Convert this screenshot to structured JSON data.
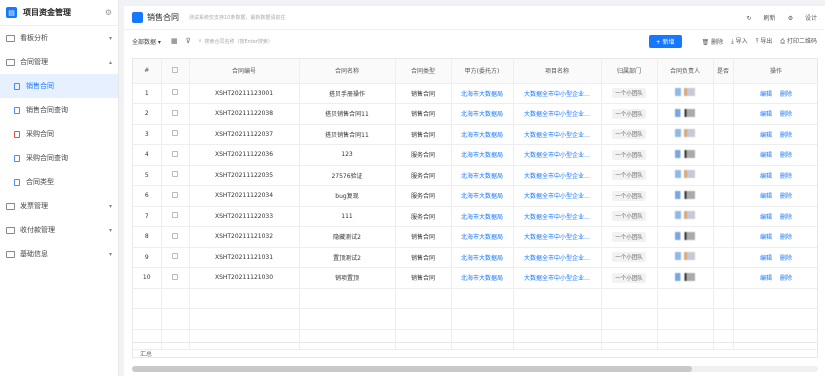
{
  "app": {
    "title": "项目资金管理"
  },
  "sidebar": {
    "items": [
      {
        "label": "看板分析"
      },
      {
        "label": "合同管理"
      },
      {
        "label": "发票管理"
      },
      {
        "label": "收付款管理"
      },
      {
        "label": "基础信息"
      }
    ],
    "subitems": [
      {
        "label": "销售合同"
      },
      {
        "label": "销售合同查询"
      },
      {
        "label": "采购合同"
      },
      {
        "label": "采购合同查询"
      },
      {
        "label": "合同类型"
      }
    ]
  },
  "page": {
    "title": "销售合同",
    "info": "测试系统仅支持10条数据，最新数据请前往"
  },
  "top_actions": {
    "refresh": "刷新",
    "design": "设计"
  },
  "toolbar": {
    "scope": "全部数据",
    "search_placeholder": "搜索合同名称（按Enter搜索）",
    "new_label": "+ 新增",
    "delete_label": "删除",
    "import_label": "导入",
    "export_label": "导出",
    "print_label": "打印二维码"
  },
  "table": {
    "headers": [
      "#",
      "",
      "合同编号",
      "合同名称",
      "合同类型",
      "甲方(委托方)",
      "项目名称",
      "归属部门",
      "合同负责人",
      "是否",
      "操作"
    ],
    "rows": [
      {
        "no": "1",
        "code": "XSHT20211123001",
        "name": "搭贝手册操作",
        "type": "销售合同",
        "party": "北海市大数据局",
        "project": "大数据全市中小型企业…",
        "dept": "一个小团队"
      },
      {
        "no": "2",
        "code": "XSHT20211122038",
        "name": "搭贝销售合同11",
        "type": "销售合同",
        "party": "北海市大数据局",
        "project": "大数据全市中小型企业…",
        "dept": "一个小团队"
      },
      {
        "no": "3",
        "code": "XSHT20211122037",
        "name": "搭贝销售合同11",
        "type": "销售合同",
        "party": "北海市大数据局",
        "project": "大数据全市中小型企业…",
        "dept": "一个小团队"
      },
      {
        "no": "4",
        "code": "XSHT20211122036",
        "name": "123",
        "type": "服务合同",
        "party": "北海市大数据局",
        "project": "大数据全市中小型企业…",
        "dept": "一个小团队"
      },
      {
        "no": "5",
        "code": "XSHT20211122035",
        "name": "27576验证",
        "type": "服务合同",
        "party": "北海市大数据局",
        "project": "大数据全市中小型企业…",
        "dept": "一个小团队"
      },
      {
        "no": "6",
        "code": "XSHT20211122034",
        "name": "bug复现",
        "type": "服务合同",
        "party": "北海市大数据局",
        "project": "大数据全市中小型企业…",
        "dept": "一个小团队"
      },
      {
        "no": "7",
        "code": "XSHT20211122033",
        "name": "111",
        "type": "服务合同",
        "party": "北海市大数据局",
        "project": "大数据全市中小型企业…",
        "dept": "一个小团队"
      },
      {
        "no": "8",
        "code": "XSHT20211121032",
        "name": "隐藏测试2",
        "type": "销售合同",
        "party": "北海市大数据局",
        "project": "大数据全市中小型企业…",
        "dept": "一个小团队"
      },
      {
        "no": "9",
        "code": "XSHT20211121031",
        "name": "置顶测试2",
        "type": "销售合同",
        "party": "北海市大数据局",
        "project": "大数据全市中小型企业…",
        "dept": "一个小团队"
      },
      {
        "no": "10",
        "code": "XSHT20211121030",
        "name": "销项置顶",
        "type": "销售合同",
        "party": "北海市大数据局",
        "project": "大数据全市中小型企业…",
        "dept": "一个小团队"
      }
    ],
    "edit_label": "编辑",
    "delete_label": "删除",
    "summary_label": "汇总"
  }
}
